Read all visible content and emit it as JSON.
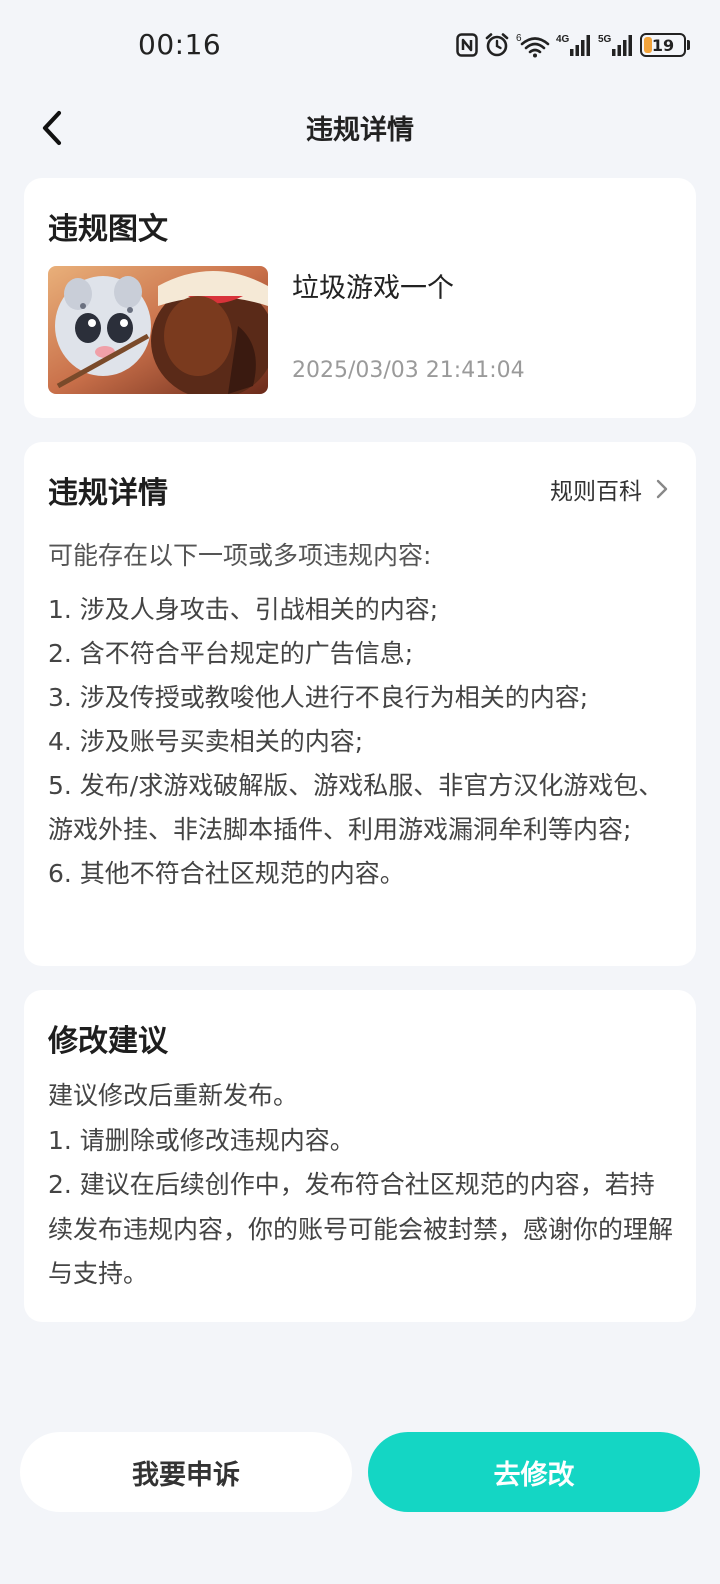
{
  "status_bar": {
    "time": "00:16",
    "battery": "19",
    "wifi_badge": "6",
    "net1": "4G",
    "net2": "5G"
  },
  "nav": {
    "title": "违规详情"
  },
  "violation_post": {
    "section_title": "违规图文",
    "text": "垃圾游戏一个",
    "timestamp": "2025/03/03 21:41:04"
  },
  "violation_details": {
    "section_title": "违规详情",
    "rule_link_label": "规则百科",
    "intro": "可能存在以下一项或多项违规内容:",
    "items": [
      "1. 涉及人身攻击、引战相关的内容;",
      "2. 含不符合平台规定的广告信息;",
      "3. 涉及传授或教唆他人进行不良行为相关的内容;",
      "4. 涉及账号买卖相关的内容;",
      "5. 发布/求游戏破解版、游戏私服、非官方汉化游戏包、游戏外挂、非法脚本插件、利用游戏漏洞牟利等内容;",
      "6. 其他不符合社区规范的内容。"
    ]
  },
  "suggestions": {
    "section_title": "修改建议",
    "lines": [
      "建议修改后重新发布。",
      "1. 请删除或修改违规内容。",
      "2. 建议在后续创作中，发布符合社区规范的内容，若持续发布违规内容，你的账号可能会被封禁，感谢你的理解与支持。"
    ]
  },
  "actions": {
    "appeal_label": "我要申诉",
    "modify_label": "去修改"
  },
  "colors": {
    "accent": "#14d6c4",
    "background": "#f3f5f9"
  }
}
